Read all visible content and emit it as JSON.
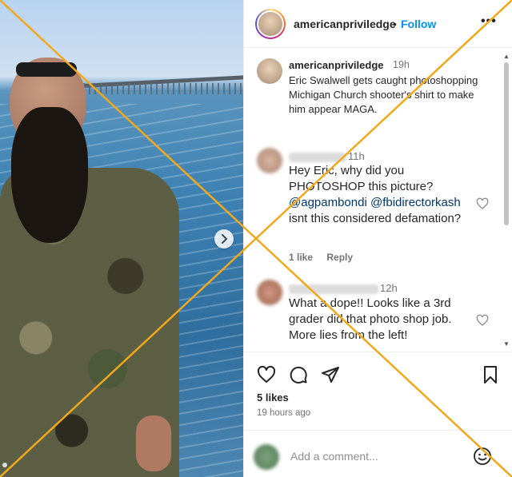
{
  "post": {
    "username": "americanpriviledge",
    "separator": "•",
    "follow_label": "Follow",
    "more_label": "•••",
    "caption": {
      "username": "americanpriviledge",
      "time": "19h",
      "text": "Eric Swalwell gets caught photoshopping Michigan Church shooter's shirt to make him appear MAGA."
    },
    "comments": [
      {
        "time": "11h",
        "text_before": "Hey Eric, why did you PHOTOSHOP this picture?",
        "mention1": "@agpambondi",
        "mention2": "@fbidirectorkash",
        "text_after": "isnt this considered defamation?",
        "likes_label": "1 like",
        "reply_label": "Reply"
      },
      {
        "time": "12h",
        "text": "What a dope!! Looks like a 3rd grader did that photo shop job. More lies from the left!"
      }
    ],
    "likes": "5 likes",
    "ago": "19 hours ago",
    "add_comment_placeholder": "Add a comment..."
  },
  "icons": {
    "heart": "heart-icon",
    "comment": "comment-icon",
    "share": "paper-plane-icon",
    "save": "bookmark-icon",
    "emoji": "smiley-icon",
    "next": "chevron-right-icon"
  },
  "colors": {
    "link_blue": "#0095f6",
    "mention": "#00376b",
    "overlay_x": "#f0a81c"
  }
}
